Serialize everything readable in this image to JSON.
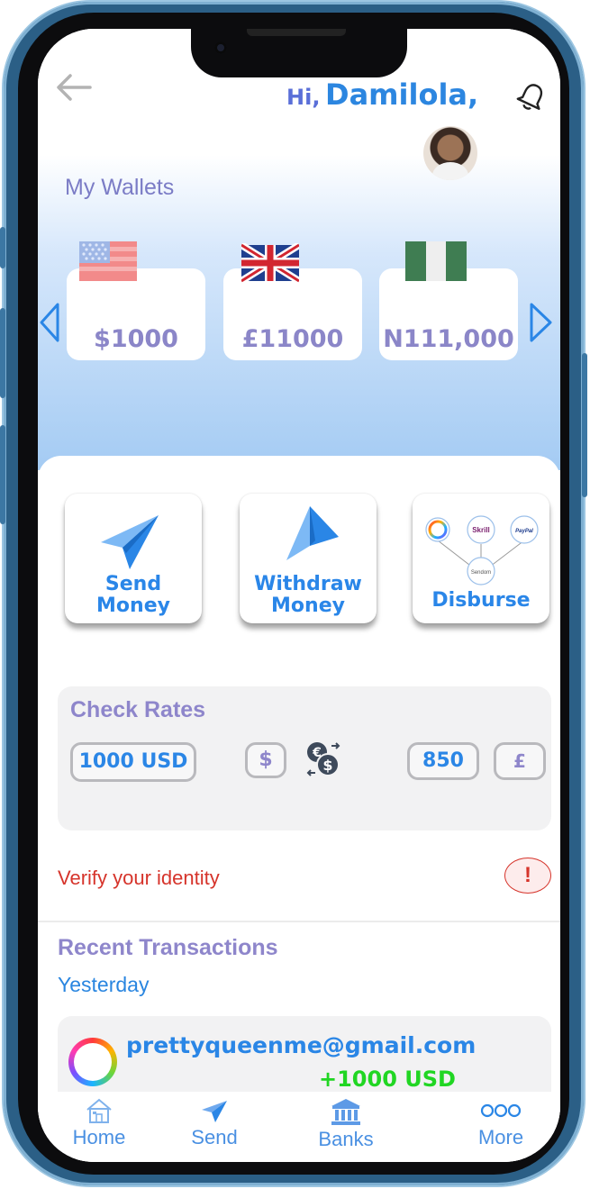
{
  "header": {
    "greeting_hi": "Hi,",
    "greeting_name": "Damilola,"
  },
  "wallets": {
    "title": "My Wallets",
    "cards": [
      {
        "currency_flag": "us-flag-icon",
        "amount": "$1000"
      },
      {
        "currency_flag": "uk-flag-icon",
        "amount": "£11000"
      },
      {
        "currency_flag": "ng-flag-icon",
        "amount": "N111,000"
      }
    ]
  },
  "actions": {
    "send": {
      "line1": "Send",
      "line2": "Money"
    },
    "withdraw": {
      "line1": "Withdraw",
      "line2": "Money"
    },
    "disburse": {
      "label": "Disburse",
      "nodes": [
        "Skrill",
        "PayPal",
        "Sendom"
      ]
    }
  },
  "rates": {
    "title": "Check Rates",
    "from_amount": "1000 USD",
    "from_symbol": "$",
    "to_amount": "850",
    "to_symbol": "£"
  },
  "verify": {
    "text": "Verify your identity",
    "badge": "!"
  },
  "transactions": {
    "title": "Recent Transactions",
    "group_label": "Yesterday",
    "items": [
      {
        "email": "prettyqueenme@gmail.com",
        "amount": "+1000 USD"
      }
    ]
  },
  "nav": {
    "items": [
      {
        "label": "Home",
        "icon": "home-icon"
      },
      {
        "label": "Send",
        "icon": "send-icon"
      },
      {
        "label": "Banks",
        "icon": "bank-icon"
      },
      {
        "label": "More",
        "icon": "more-icon"
      }
    ]
  },
  "colors": {
    "accent_blue": "#2a86e6",
    "accent_purple": "#8e86cb",
    "alert_red": "#d6342b",
    "positive_green": "#21d623",
    "device_frame": "#2b5f86"
  }
}
